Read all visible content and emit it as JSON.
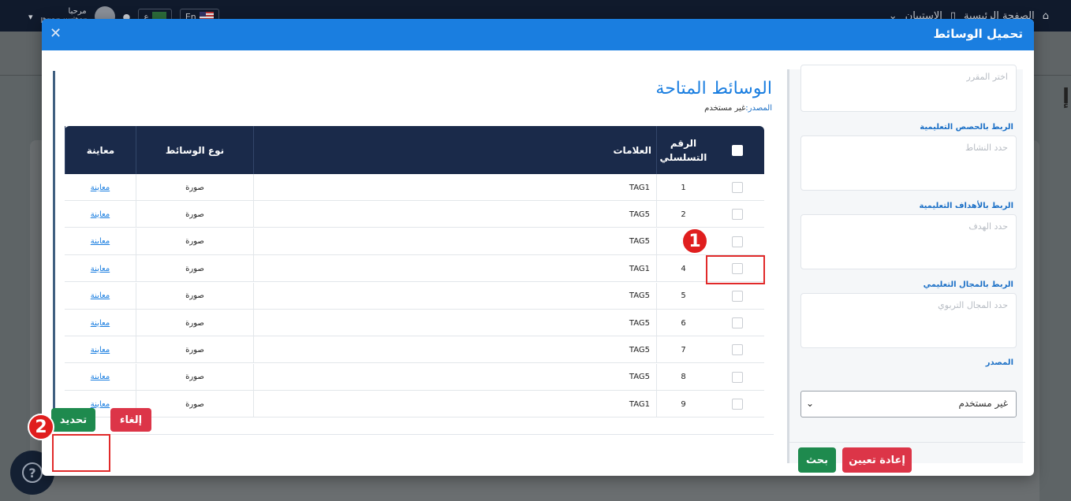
{
  "app": {
    "nav": {
      "home": "الصفحة الرئيسية",
      "survey": "الاستبيان",
      "greeting": "مرحبا",
      "user": "Itqan writer",
      "lang_ar": "ع",
      "lang_en": "En"
    },
    "bg_title": "إ"
  },
  "modal": {
    "title": "تحميل الوسائط",
    "close_icon": "close-icon"
  },
  "filters": {
    "course_placeholder": "اختر المقرر",
    "lessons_label": "الربط بالحصص التعليمية",
    "lessons_placeholder": "حدد النشاط",
    "goals_label": "الربط بالأهداف التعليمية",
    "goals_placeholder": "حدد الهدف",
    "domain_label": "الربط بالمجال التعليمي",
    "domain_placeholder": "حدد المجال التربوي",
    "source_label": "المصدر",
    "source_value": "غير مستخدم",
    "reset_button": "إعادة تعيين",
    "search_button": "بحث"
  },
  "media": {
    "title": "الوسائط المتاحة",
    "source_key": "المصدر:",
    "source_value": "غير مستخدم",
    "columns": {
      "serial": "الرقم التسلسلي",
      "tags": "العلامات",
      "type": "نوع الوسائط",
      "preview": "معاينة"
    },
    "rows": [
      {
        "n": "1",
        "tag": "TAG1",
        "type": "صورة",
        "preview": "معاينة"
      },
      {
        "n": "2",
        "tag": "TAG5",
        "type": "صورة",
        "preview": "معاينة"
      },
      {
        "n": "3",
        "tag": "TAG5",
        "type": "صورة",
        "preview": "معاينة"
      },
      {
        "n": "4",
        "tag": "TAG1",
        "type": "صورة",
        "preview": "معاينة"
      },
      {
        "n": "5",
        "tag": "TAG5",
        "type": "صورة",
        "preview": "معاينة"
      },
      {
        "n": "6",
        "tag": "TAG5",
        "type": "صورة",
        "preview": "معاينة"
      },
      {
        "n": "7",
        "tag": "TAG5",
        "type": "صورة",
        "preview": "معاينة"
      },
      {
        "n": "8",
        "tag": "TAG5",
        "type": "صورة",
        "preview": "معاينة"
      },
      {
        "n": "9",
        "tag": "TAG1",
        "type": "صورة",
        "preview": "معاينة"
      }
    ],
    "select_button": "تحديد",
    "cancel_button": "إلغاء"
  },
  "annotations": {
    "badge1": "1",
    "badge2": "2",
    "highlight_color": "#e12a2a"
  },
  "colors": {
    "header": "#1a7ee0",
    "table_head": "#1a2a4a",
    "primary_green": "#1e8a4e",
    "danger_red": "#dc3548"
  }
}
